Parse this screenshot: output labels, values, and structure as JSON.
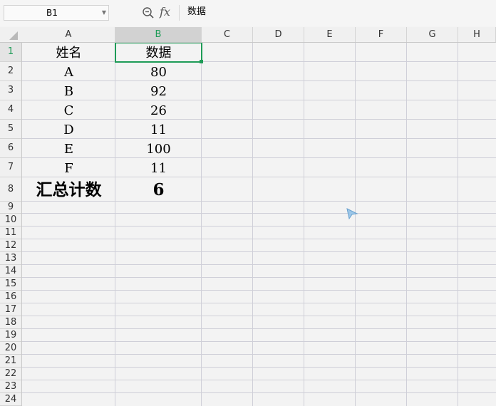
{
  "formula_bar": {
    "name_box": "B1",
    "fx_label": "fx",
    "content": "数据"
  },
  "columns": [
    "A",
    "B",
    "C",
    "D",
    "E",
    "F",
    "G",
    "H"
  ],
  "active_column": "B",
  "rows": [
    "1",
    "2",
    "3",
    "4",
    "5",
    "6",
    "7",
    "8",
    "9",
    "10",
    "11",
    "12",
    "13",
    "14",
    "15",
    "16",
    "17",
    "18",
    "19",
    "20",
    "21",
    "22",
    "23",
    "24"
  ],
  "active_row": "1",
  "cells": {
    "A1": "姓名",
    "B1": "数据",
    "A2": "A",
    "B2": "80",
    "A3": "B",
    "B3": "92",
    "A4": "C",
    "B4": "26",
    "A5": "D",
    "B5": "11",
    "A6": "E",
    "B6": "100",
    "A7": "F",
    "B7": "11",
    "A8": "汇总计数",
    "B8": "6"
  },
  "colors": {
    "accent": "#1e9b57",
    "grid": "#cfcfd8",
    "header_bg": "#f0f0f0"
  },
  "icons": {
    "zoom": "zoom-formula-icon",
    "cursor": "mouse-cursor-icon"
  }
}
